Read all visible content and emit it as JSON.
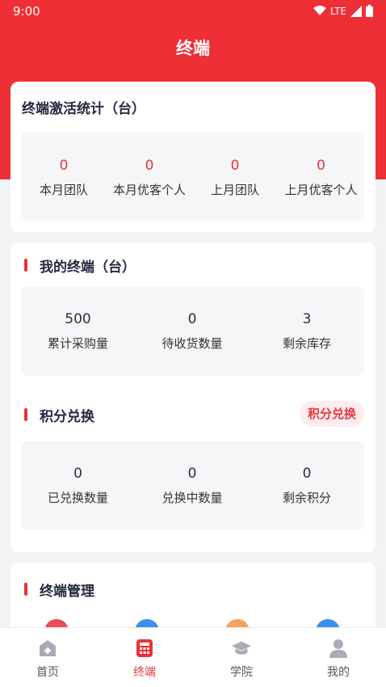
{
  "status_bar": {
    "time": "9:00",
    "network": "LTE"
  },
  "page": {
    "title": "终端"
  },
  "activation": {
    "title": "终端激活统计（台）",
    "stats": [
      {
        "value": "0",
        "label": "本月团队"
      },
      {
        "value": "0",
        "label": "本月优客个人"
      },
      {
        "value": "0",
        "label": "上月团队"
      },
      {
        "value": "0",
        "label": "上月优客个人"
      }
    ]
  },
  "my_terminals": {
    "title": "我的终端（台）",
    "stats": [
      {
        "value": "500",
        "label": "累计采购量"
      },
      {
        "value": "0",
        "label": "待收货数量"
      },
      {
        "value": "3",
        "label": "剩余库存"
      }
    ]
  },
  "points": {
    "title": "积分兑换",
    "button_label": "积分兑换",
    "stats": [
      {
        "value": "0",
        "label": "已兑换数量"
      },
      {
        "value": "0",
        "label": "兑换中数量"
      },
      {
        "value": "0",
        "label": "剩余积分"
      }
    ]
  },
  "management": {
    "title": "终端管理",
    "icons": [
      {
        "icon": "record-icon",
        "color": "#ef4b52"
      },
      {
        "icon": "calendar-icon",
        "color": "#3b8ef0"
      },
      {
        "icon": "star-icon",
        "color": "#f5a25d"
      },
      {
        "icon": "user-icon",
        "color": "#3b8ef0"
      }
    ]
  },
  "tabs": [
    {
      "icon": "home-icon",
      "label": "首页",
      "active": false
    },
    {
      "icon": "terminal-icon",
      "label": "终端",
      "active": true
    },
    {
      "icon": "graduation-cap-icon",
      "label": "学院",
      "active": false
    },
    {
      "icon": "person-icon",
      "label": "我的",
      "active": false
    }
  ],
  "colors": {
    "brand": "#ef2f36",
    "accent_text": "#e8353b",
    "background": "#f2f3f5"
  }
}
